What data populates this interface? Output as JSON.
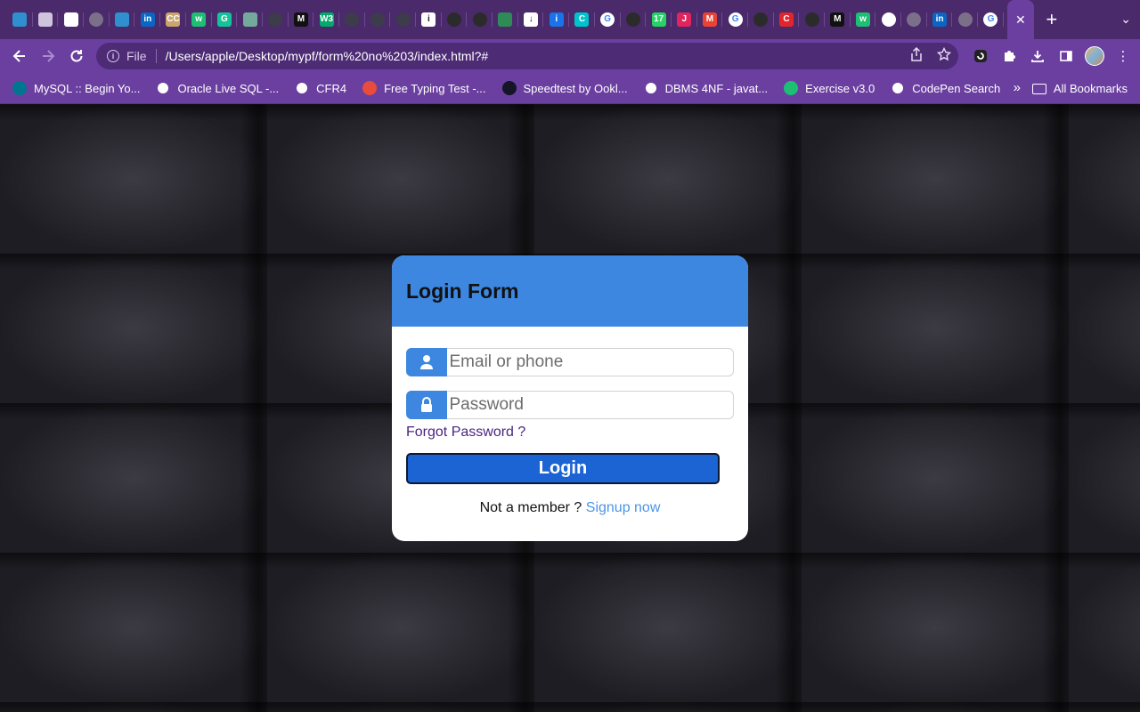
{
  "browser": {
    "tabs": [
      {
        "icon": "rainbow-logo-icon",
        "color": "#2f8fcf"
      },
      {
        "icon": "chess-icon",
        "color": "#cfc4dd"
      },
      {
        "icon": "white-square-icon",
        "color": "#ffffff"
      },
      {
        "icon": "globe-icon",
        "color": "#7b6f8a"
      },
      {
        "icon": "rainbow-logo-icon",
        "color": "#2f8fcf"
      },
      {
        "icon": "linkedin-icon",
        "color": "#0a66c2",
        "text": "in"
      },
      {
        "icon": "cc-icon",
        "color": "#caa56c",
        "text": "CC"
      },
      {
        "icon": "wordwall-icon",
        "color": "#1dbf73",
        "text": "w"
      },
      {
        "icon": "grammarly-icon",
        "color": "#15c39a",
        "text": "G"
      },
      {
        "icon": "chatgpt-icon",
        "color": "#74aa9c"
      },
      {
        "icon": "dark-square-icon",
        "color": "#3c3c4a"
      },
      {
        "icon": "medium-icon",
        "color": "#111111",
        "text": "M"
      },
      {
        "icon": "w3schools-icon",
        "color": "#04aa6d",
        "text": "W3"
      },
      {
        "icon": "dark-square-icon",
        "color": "#3c3c4a"
      },
      {
        "icon": "dark-square-icon",
        "color": "#3c3c4a"
      },
      {
        "icon": "dark-square-icon",
        "color": "#3c3c4a"
      },
      {
        "icon": "info-icon",
        "color": "#ffffff",
        "text": "i"
      },
      {
        "icon": "github-icon",
        "color": "#2b2b2b"
      },
      {
        "icon": "github-icon",
        "color": "#2b2b2b"
      },
      {
        "icon": "leaf-icon",
        "color": "#2e8b57"
      },
      {
        "icon": "download-icon",
        "color": "#ffffff",
        "text": "↓"
      },
      {
        "icon": "info-square-icon",
        "color": "#1a73e8",
        "text": "i"
      },
      {
        "icon": "canva-icon",
        "color": "#00c4cc",
        "text": "C"
      },
      {
        "icon": "google-icon",
        "color": "#ffffff",
        "text": "G"
      },
      {
        "icon": "github-icon",
        "color": "#2b2b2b"
      },
      {
        "icon": "whatsapp-badge-icon",
        "color": "#25d366",
        "text": "17"
      },
      {
        "icon": "j-icon",
        "color": "#e0245e",
        "text": "J"
      },
      {
        "icon": "gmail-icon",
        "color": "#ea4335",
        "text": "M"
      },
      {
        "icon": "google-icon",
        "color": "#ffffff",
        "text": "G"
      },
      {
        "icon": "github-icon",
        "color": "#2b2b2b"
      },
      {
        "icon": "red-c-icon",
        "color": "#e0262c",
        "text": "C"
      },
      {
        "icon": "github-icon",
        "color": "#2b2b2b"
      },
      {
        "icon": "medium-icon",
        "color": "#111111",
        "text": "M"
      },
      {
        "icon": "wordwall-icon",
        "color": "#1dbf73",
        "text": "w"
      },
      {
        "icon": "chrome-icon",
        "color": "#ffffff"
      },
      {
        "icon": "globe-icon",
        "color": "#7b6f8a"
      },
      {
        "icon": "linkedin-icon",
        "color": "#0a66c2",
        "text": "in"
      },
      {
        "icon": "globe-icon",
        "color": "#7b6f8a"
      },
      {
        "icon": "google-icon",
        "color": "#ffffff",
        "text": "G"
      }
    ],
    "active_tab_close": "✕",
    "new_tab": "+",
    "tab_menu": "⌄",
    "address": {
      "scheme": "File",
      "url": "/Users/apple/Desktop/mypf/form%20no%203/index.html?#"
    },
    "bookmarks": [
      {
        "label": "MySQL :: Begin Yo...",
        "icon": "mysql-icon",
        "color": "#00758f"
      },
      {
        "label": "Oracle Live SQL -...",
        "icon": "globe-icon",
        "color": "#ffffff"
      },
      {
        "label": "CFR4",
        "icon": "gear-icon",
        "color": "#ffffff"
      },
      {
        "label": "Free Typing Test -...",
        "icon": "typing-icon",
        "color": "#e84c3d"
      },
      {
        "label": "Speedtest by Ookl...",
        "icon": "speedometer-icon",
        "color": "#141526"
      },
      {
        "label": "DBMS 4NF - javat...",
        "icon": "globe-icon",
        "color": "#ffffff"
      },
      {
        "label": "Exercise v3.0",
        "icon": "wordwall-icon",
        "color": "#1dbf73"
      },
      {
        "label": "CodePen Search",
        "icon": "codepen-icon",
        "color": "#ffffff"
      }
    ],
    "bookmarks_more": "»",
    "all_bookmarks": "All Bookmarks"
  },
  "login": {
    "title": "Login Form",
    "email_placeholder": "Email or phone",
    "password_placeholder": "Password",
    "forgot": "Forgot Password ?",
    "button": "Login",
    "signup_prompt": "Not a member ?",
    "signup_link": "Signup now"
  },
  "colors": {
    "accent": "#3d87e0",
    "button": "#1c63d4",
    "link": "#4a95e8",
    "forgot": "#4a2580",
    "browser_frame": "#6b3fa0"
  }
}
